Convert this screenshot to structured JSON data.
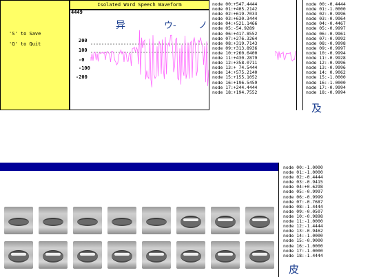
{
  "window": {
    "title": "Isolated Word Speech Waveform"
  },
  "controls": {
    "save_hint": "'S' to Save",
    "quit_hint": "'Q' to Quit"
  },
  "waveform": {
    "max_label": "4449",
    "ticks": [
      "200",
      "100",
      "-0",
      "-100",
      "-200"
    ],
    "phonemes": [
      "异",
      "ウ-",
      "ノ"
    ],
    "color": "#ff66ff"
  },
  "node_list_1": [
    "node 00:+547.4444",
    "node 01:+405.2142",
    "node 02:+619.7033",
    "node 03:+630.3444",
    "node 04:+521.1466",
    "node 05:-54.9289",
    "node 06:+417.8552",
    "node 07:+276.3264",
    "node 08:+319.7143",
    "node 09:+313.8936",
    "node 10:+260.6400",
    "node 11:+430.2879",
    "node 12:+358.0711",
    "node 13:+ 74.5444",
    "node 14:+575.2140",
    "node 15:+155.1052",
    "node 16:+196.5459",
    "node 17:+244.4444",
    "node 18:+194.7552"
  ],
  "node_list_2": [
    "node 00:-0.4444",
    "node 01:-1.0000",
    "node 02:-0.9996",
    "node 03:-0.9964",
    "node 04:-0.4467",
    "node 05:-0.9997",
    "node 06:-0.9961",
    "node 07:-0.9992",
    "node 08:-0.9998",
    "node 09:-0.9997",
    "node 10:-0.9994",
    "node 11:-0.9928",
    "node 12:-0.9996",
    "node 13:-0.9996",
    "node 14: 0.9062",
    "node 15:-1.0000",
    "node 16:-1.0000",
    "node 17:-0.9994",
    "node 18:-0.9994"
  ],
  "node_list_3": [
    "node 00:-1.0000",
    "node 01:-1.0000",
    "node 02:-0.4444",
    "node 03:-0.9415",
    "node 04:+0.6298",
    "node 05:-0.9997",
    "node 06:-0.9999",
    "node 07:-0.7687",
    "node 08:-1.4444",
    "node 09:-0.0507",
    "node 10:-0.9898",
    "node 11:-1.0000",
    "node 12:-1.4444",
    "node 13:-0.9462",
    "node 14:-1.0000",
    "node 15:-0.9000",
    "node 16:-1.0000",
    "node 17:-1.0000",
    "node 18:-1.4444"
  ],
  "results": {
    "top_char": "及",
    "bottom_char": "皮"
  }
}
